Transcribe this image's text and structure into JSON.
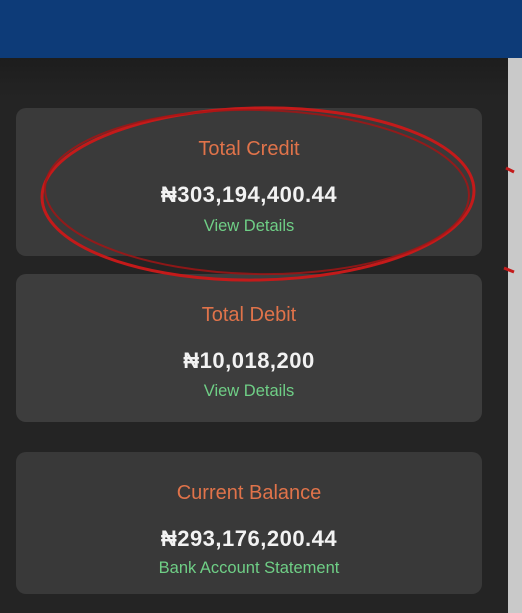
{
  "cards": {
    "credit": {
      "label": "Total Credit",
      "amount": "₦303,194,400.44",
      "link": "View Details"
    },
    "debit": {
      "label": "Total Debit",
      "amount": "₦10,018,200",
      "link": "View Details"
    },
    "balance": {
      "label": "Current Balance",
      "amount": "₦293,176,200.44",
      "link": "Bank Account Statement"
    }
  },
  "colors": {
    "header": "#0d3b78",
    "card_background": "#3a3a3a",
    "label": "#e0734a",
    "link": "#6fcf86",
    "annotation": "#c41a1a"
  }
}
